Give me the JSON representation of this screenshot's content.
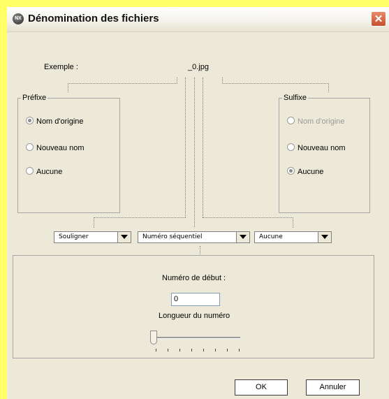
{
  "window": {
    "title": "Dénomination des fichiers",
    "close_glyph": "✕",
    "app_icon_text": "NX"
  },
  "example": {
    "label": "Exemple :",
    "value": "_0.jpg"
  },
  "prefix": {
    "legend": "Préfixe",
    "options": [
      {
        "label": "Nom d'origine",
        "selected": true,
        "disabled": false
      },
      {
        "label": "Nouveau nom",
        "selected": false,
        "disabled": false
      },
      {
        "label": "Aucune",
        "selected": false,
        "disabled": false
      }
    ]
  },
  "suffix": {
    "legend": "Sulfixe",
    "options": [
      {
        "label": "Nom d'origine",
        "selected": false,
        "disabled": true
      },
      {
        "label": "Nouveau nom",
        "selected": false,
        "disabled": false
      },
      {
        "label": "Aucune",
        "selected": true,
        "disabled": false
      }
    ]
  },
  "combos": {
    "separator": "Souligner",
    "middle": "Numéro séquentiel",
    "suffix_sep": "Aucune"
  },
  "numbering": {
    "start_label": "Numéro de début :",
    "start_value": "0",
    "length_label": "Longueur du numéro",
    "length_level": 0
  },
  "buttons": {
    "ok": "OK",
    "cancel": "Annuler"
  }
}
